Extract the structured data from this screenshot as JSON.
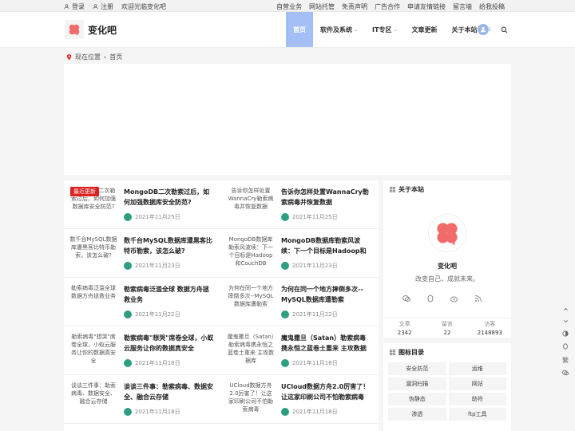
{
  "topbar": {
    "login": "登录",
    "register": "注册",
    "welcome": "欢迎光临变化吧",
    "links": [
      "自营业务",
      "网站托管",
      "免责声明",
      "广告合作",
      "申请友情链接",
      "留言墙",
      "给我投稿"
    ]
  },
  "header": {
    "site_name": "变化吧",
    "nav": [
      {
        "label": "首页",
        "active": true,
        "caret": false
      },
      {
        "label": "软件及系统",
        "active": false,
        "caret": true
      },
      {
        "label": "IT专区",
        "active": false,
        "caret": true
      },
      {
        "label": "文章更新",
        "active": false,
        "caret": false
      },
      {
        "label": "关于本站",
        "active": false,
        "caret": true
      }
    ],
    "caret_glyph": "⌄",
    "more_glyph": "⋮"
  },
  "breadcrumb": {
    "prefix": "现在位置",
    "current": "首页"
  },
  "posts": [
    {
      "thumb": "MongoDB二次勒索过后，如何加强数据库安全防范?",
      "title": "MongoDB二次勒索过后，如何加强数据库安全防范?",
      "date": "2021年11月25日",
      "badge": "最近更新"
    },
    {
      "thumb": "告诉你怎样处置WannaCry勒索病毒并恢复数据",
      "title": "告诉你怎样处置WannaCry勒索病毒并恢复数据",
      "date": "2021年11月25日"
    },
    {
      "thumb": "数千台MySQL数据库遭黑客比特币勒索，该怎么破?",
      "title": "数千台MySQL数据库遭黑客比特币勒索，该怎么破?",
      "date": "2021年11月23日"
    },
    {
      "thumb": "MongoDB数据库勒索风波续：下一个目标是Hadoop和CouchDB",
      "title": "MongoDB数据库勒索风波续：下一个目标是Hadoop和CouchDB",
      "date": "2021年11月23日"
    },
    {
      "thumb": "勒索病毒泛滥全球 数据方舟拯救业务",
      "title": "勒索病毒泛滥全球 数据方舟拯救业务",
      "date": "2021年11月22日"
    },
    {
      "thumb": "为何在同一个地方摔倒多次--MySQL数据库遭勒索",
      "title": "为何在同一个地方摔倒多次--MySQL数据库遭勒索",
      "date": "2021年11月22日"
    },
    {
      "thumb": "勒索病毒\"想哭\"席卷全球，小蚁云服务让你的数据真安全",
      "title": "勒索病毒\"想哭\"席卷全球，小蚁云服务让你的数据真安全",
      "date": "2021年11月18日"
    },
    {
      "thumb": "魔鬼撒旦（Satan）勒索病毒携永恒之蓝卷土重来 主攻数据库",
      "title": "魔鬼撒旦（Satan）勒索病毒携永恒之蓝卷土重来 主攻数据库",
      "date": "2021年11月18日"
    },
    {
      "thumb": "谈谈三件事：勒索病毒、数据安全、融合云存储",
      "title": "谈谈三件事：勒索病毒、数据安全、融合云存储",
      "date": "2021年11月18日"
    },
    {
      "thumb": "UCloud数据方舟2.0厉害了！让这家印刷公司不怕勒索病毒",
      "title": "UCloud数据方舟2.0厉害了！让这家印刷公司不怕勒索病毒",
      "date": "2021年11月18日"
    }
  ],
  "about": {
    "title": "关于本站",
    "name": "变化吧",
    "motto": "改变自己，成就未来。",
    "stats": [
      {
        "label": "文章",
        "value": "2342"
      },
      {
        "label": "留言",
        "value": "22"
      },
      {
        "label": "访客",
        "value": "2148893"
      }
    ]
  },
  "tags": {
    "title": "图标目录",
    "items": [
      "安全防范",
      "运维",
      "漏洞扫描",
      "网站",
      "伪静态",
      "助符",
      "渗透",
      "ftp工具"
    ]
  },
  "float_tools": {
    "lang": "繁"
  },
  "colors": {
    "accent": "#a4bef6",
    "badge": "#e02020",
    "date_dot": "#2e9e83",
    "logo": "#f26b6b"
  }
}
